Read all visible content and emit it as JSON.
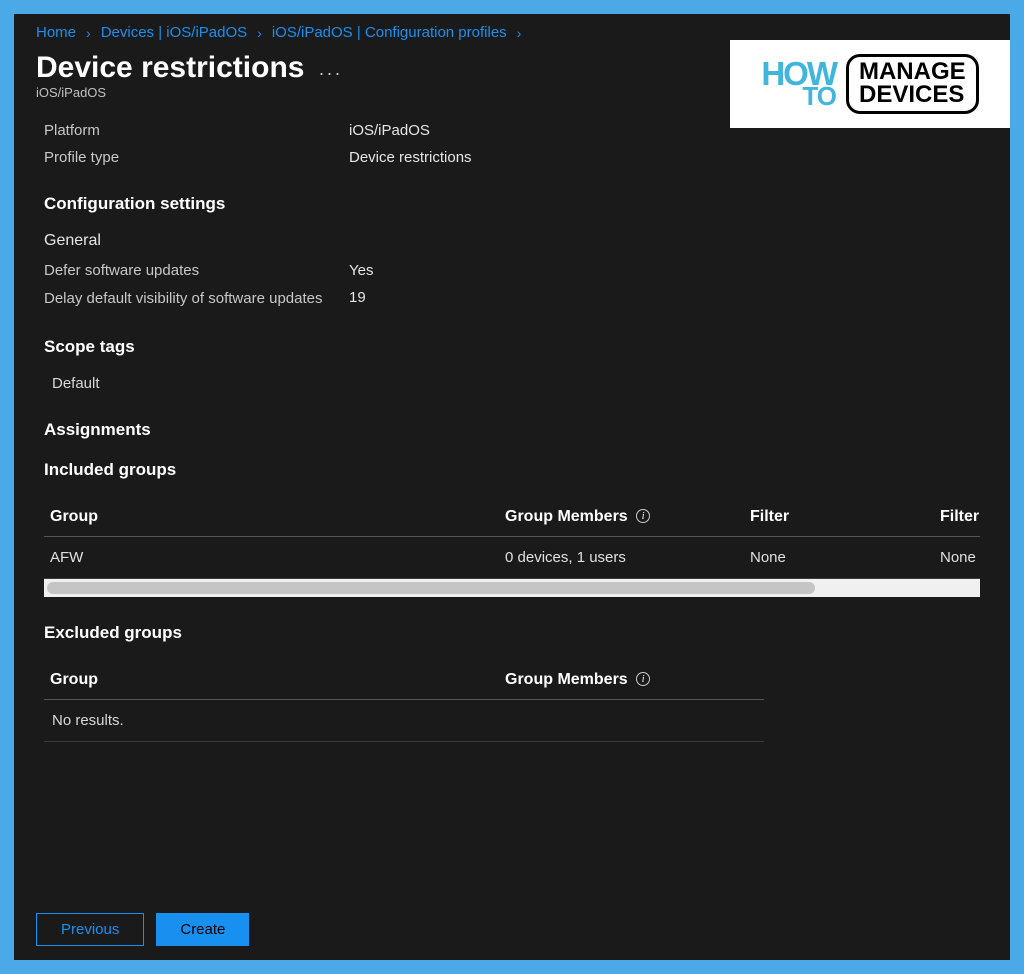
{
  "breadcrumbs": {
    "home": "Home",
    "devices": "Devices | iOS/iPadOS",
    "profiles": "iOS/iPadOS | Configuration profiles"
  },
  "header": {
    "title": "Device restrictions",
    "subtitle": "iOS/iPadOS",
    "more": "···"
  },
  "logo": {
    "how": "HOW",
    "to": "TO",
    "line1": "MANAGE",
    "line2": "DEVICES"
  },
  "basics": {
    "platform_label": "Platform",
    "platform_value": "iOS/iPadOS",
    "profiletype_label": "Profile type",
    "profiletype_value": "Device restrictions"
  },
  "config": {
    "title": "Configuration settings",
    "general_heading": "General",
    "defer_label": "Defer software updates",
    "defer_value": "Yes",
    "delay_label": "Delay default visibility of software updates",
    "delay_value": "19"
  },
  "scope": {
    "title": "Scope tags",
    "tag": "Default"
  },
  "assignments": {
    "title": "Assignments",
    "included_title": "Included groups",
    "excluded_title": "Excluded groups",
    "col_group": "Group",
    "col_members": "Group Members",
    "col_filter": "Filter",
    "col_filter2": "Filter",
    "row1_group": "AFW",
    "row1_members": "0 devices, 1 users",
    "row1_filter": "None",
    "row1_filter2": "None",
    "no_results": "No results."
  },
  "footer": {
    "prev": "Previous",
    "create": "Create"
  }
}
